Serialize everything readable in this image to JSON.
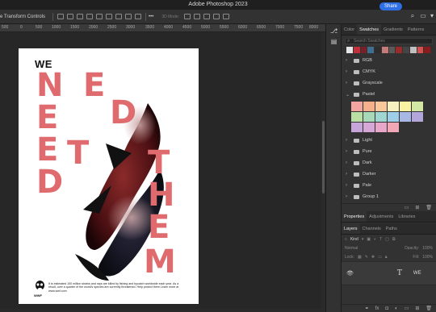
{
  "window": {
    "title": "Adobe Photoshop 2023"
  },
  "options_bar": {
    "transform_label": "e Transform Controls",
    "mode_3d": "3D Mode:"
  },
  "header": {
    "share_label": "Share"
  },
  "ruler": {
    "ticks": [
      "500",
      "0",
      "500",
      "1000",
      "1500",
      "2000",
      "2500",
      "3000",
      "3500",
      "4000",
      "4500",
      "5000",
      "5500",
      "6000",
      "6500",
      "7000",
      "7500",
      "8000",
      "8500",
      "9000"
    ]
  },
  "document": {
    "we": "WE",
    "word1": "NEED",
    "word2": "THEM",
    "fine_print": "It is estimated 100 million sharks and rays are killed by fishing and bycatch worldwide each year. As a result, over a quarter of the world's species are currently threatened. Help protect them   Learn more at www.wwf.com",
    "logo_text": "WWF"
  },
  "swatches_panel": {
    "tabs": [
      "Color",
      "Swatches",
      "Gradients",
      "Patterns"
    ],
    "active_tab": "Swatches",
    "search_placeholder": "Search Swatches",
    "recent_colors": [
      "#e6e6e6",
      "#c0313b",
      "#7a1e2a",
      "#3f6e8f",
      "#2d2d2d",
      "#c77a7a",
      "#5a5a5a",
      "#9a2b2b",
      "#444444",
      "#bfbfbf",
      "#d55050",
      "#8c1c1c"
    ],
    "folders": [
      {
        "name": "RGB",
        "open": false
      },
      {
        "name": "CMYK",
        "open": false
      },
      {
        "name": "Grayscale",
        "open": false
      },
      {
        "name": "Pastel",
        "open": true
      }
    ],
    "pastel_colors": [
      "#f3a6a1",
      "#f5b08c",
      "#f8c79a",
      "#f7f0c0",
      "#f9f3a3",
      "#d4e8a6",
      "#b9dfa5",
      "#a7d8b8",
      "#9fd6d2",
      "#9fcfe8",
      "#a8b8e4",
      "#b2a6da",
      "#c6a6da",
      "#d6a8d8",
      "#e8a6c8",
      "#f1a7b6"
    ],
    "folders_after": [
      "Light",
      "Pure",
      "Dark",
      "Darker",
      "Pale",
      "Group 1"
    ]
  },
  "properties_panel": {
    "tabs": [
      "Properties",
      "Adjustments",
      "Libraries"
    ],
    "active_tab": "Properties"
  },
  "layers_panel": {
    "tabs": [
      "Layers",
      "Channels",
      "Paths"
    ],
    "active_tab": "Layers",
    "filter_label": "Kind",
    "blend_mode": "Normal",
    "opacity_label": "Opacity:",
    "opacity_value": "100%",
    "lock_label": "Lock:",
    "fill_label": "Fill:",
    "fill_value": "100%",
    "layers": [
      {
        "name": "WE",
        "type": "text",
        "visible": true
      }
    ]
  },
  "colors": {
    "accent": "#2f6fe6",
    "poster_red": "#e06b6e"
  }
}
